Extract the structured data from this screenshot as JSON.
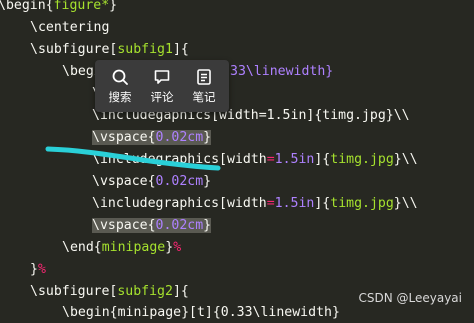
{
  "code": {
    "l1": {
      "cmd": "\\begin",
      "b1": "{",
      "arg": "figure*",
      "b2": "}"
    },
    "l2": {
      "cmd": "\\centering"
    },
    "l3": {
      "cmd": "\\subfigure",
      "b1": "[",
      "arg": "subfig1",
      "b2": "]",
      "b3": "{"
    },
    "l4": {
      "pre": "\\begi",
      "post": "33\\linewidth}"
    },
    "l5": {
      "pre": "\\",
      "post": "aphics[width=1.5in]{timg.jpg}\\\\"
    },
    "l6": {
      "pre": "\\includeg",
      "post": "aphics[width=1.5in]{timg.jpg}\\\\"
    },
    "l7": {
      "cmd": "\\vspace",
      "b1": "{",
      "num": "0.02cm",
      "b2": "}"
    },
    "l8": {
      "cmd": "\\includegraphics",
      "b1": "[",
      "key": "width",
      "eq": "=",
      "num": "1.5in",
      "b2": "]{",
      "arg": "timg.jpg",
      "b3": "}\\\\"
    },
    "l9": {
      "cmd": "\\vspace",
      "b1": "{",
      "num": "0.02cm",
      "b2": "}"
    },
    "l10": {
      "cmd": "\\includegraphics",
      "b1": "[",
      "key": "width",
      "eq": "=",
      "num": "1.5in",
      "b2": "]{",
      "arg": "timg.jpg",
      "b3": "}\\\\"
    },
    "l11": {
      "cmd": "\\vspace",
      "b1": "{",
      "num": "0.02cm",
      "b2": "}"
    },
    "l12": {
      "cmd": "\\end",
      "b1": "{",
      "arg": "minipage",
      "b2": "}",
      "pct": "%"
    },
    "l13": {
      "b1": "}",
      "pct": "%"
    },
    "l14": {
      "cmd": "\\subfigure",
      "b1": "[",
      "arg": "subfig2",
      "b2": "]",
      "b3": "{"
    },
    "l15": {
      "text": "\\begin{minipage}[t]{0.33\\linewidth}"
    }
  },
  "context_toolbar": {
    "search": {
      "label": "搜索",
      "icon": "search-icon"
    },
    "comment": {
      "label": "评论",
      "icon": "comment-icon"
    },
    "notes": {
      "label": "笔记",
      "icon": "note-icon"
    }
  },
  "watermark": "CSDN @Leeyayai",
  "colors": {
    "background": "#272822",
    "text": "#f8f8f2",
    "argument": "#a6e22e",
    "number": "#ae81ff",
    "keyword": "#f92672",
    "highlight": "#5a5a52",
    "annotation_stroke": "#2ad0d8",
    "toolbar_bg": "#3b3b3b"
  }
}
